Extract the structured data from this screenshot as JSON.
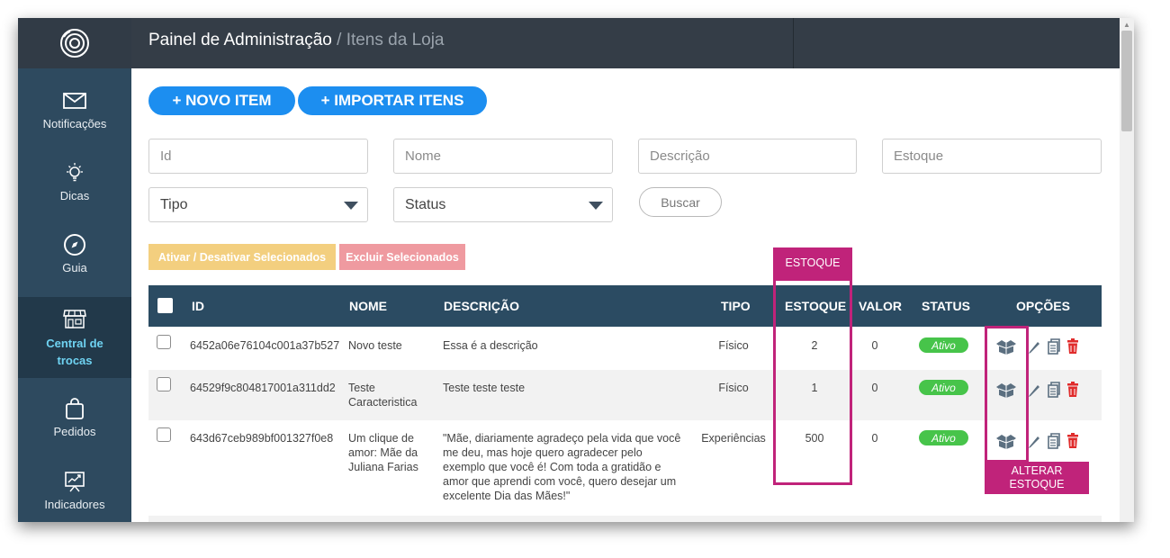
{
  "header": {
    "title": "Painel de Administração",
    "separator": " / ",
    "subtitle": "Itens da Loja"
  },
  "sidebar": {
    "items": [
      {
        "label": "Notificações",
        "icon": "envelope-icon"
      },
      {
        "label": "Dicas",
        "icon": "lightbulb-icon"
      },
      {
        "label": "Guia",
        "icon": "compass-icon"
      },
      {
        "label": "Central de trocas",
        "icon": "store-icon",
        "active": true
      },
      {
        "label": "Pedidos",
        "icon": "shopping-bag-icon"
      },
      {
        "label": "Indicadores",
        "icon": "chart-board-icon"
      }
    ]
  },
  "toolbar": {
    "new_item": "+ NOVO ITEM",
    "import_items": "+ IMPORTAR ITENS"
  },
  "filters": {
    "id_placeholder": "Id",
    "nome_placeholder": "Nome",
    "descricao_placeholder": "Descrição",
    "estoque_placeholder": "Estoque",
    "tipo_select": "Tipo",
    "status_select": "Status",
    "search_button": "Buscar"
  },
  "bulk_actions": {
    "toggle_selected": "Ativar / Desativar Selecionados",
    "delete_selected": "Excluir Selecionados"
  },
  "table": {
    "columns": [
      "ID",
      "NOME",
      "DESCRIÇÃO",
      "TIPO",
      "ESTOQUE",
      "VALOR",
      "STATUS",
      "OPÇÕES"
    ],
    "rows": [
      {
        "id": "6452a06e76104c001a37b527",
        "nome": "Novo teste",
        "descricao": "Essa é a descrição",
        "tipo": "Físico",
        "estoque": "2",
        "valor": "0",
        "status": "Ativo"
      },
      {
        "id": "64529f9c804817001a311dd2",
        "nome": "Teste Caracteristica",
        "descricao": "Teste teste teste",
        "tipo": "Físico",
        "estoque": "1",
        "valor": "0",
        "status": "Ativo"
      },
      {
        "id": "643d67ceb989bf001327f0e8",
        "nome": "Um clique de amor: Mãe da Juliana Farias",
        "descricao": "\"Mãe, diariamente agradeço pela vida que você me deu, mas hoje quero agradecer pelo exemplo que você é! Com toda a gratidão e amor que aprendi com você, quero desejar um excelente Dia das Mães!\"",
        "tipo": "Experiências",
        "estoque": "500",
        "valor": "0",
        "status": "Ativo"
      }
    ]
  },
  "annotations": {
    "estoque_label": "ESTOQUE",
    "alterar_estoque_label": "ALTERAR ESTOQUE",
    "color": "#c0237a"
  },
  "colors": {
    "primary": "#1c8ef0",
    "sidebar": "#2e4a5f",
    "header": "#343d47",
    "table_header": "#2b4b62",
    "status_active": "#47c44a",
    "delete": "#e02c2c"
  }
}
